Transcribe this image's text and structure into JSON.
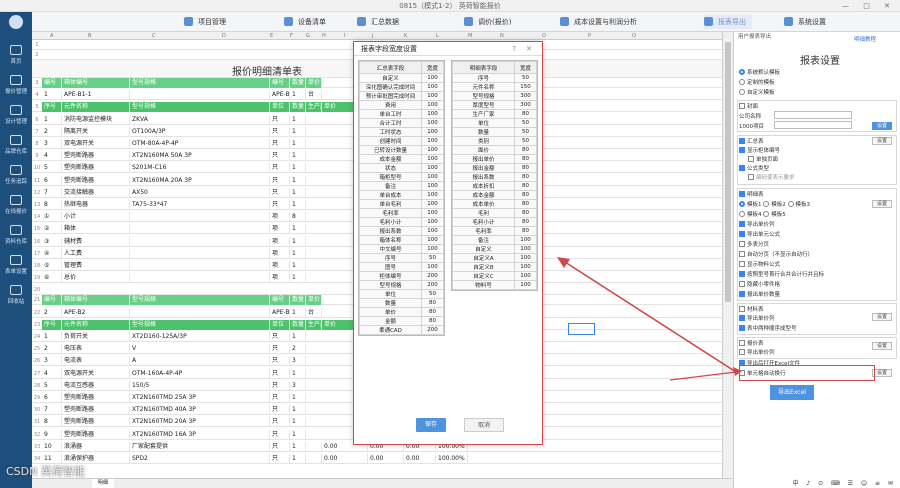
{
  "window": {
    "title": "0815（模式1-2） 英荷智能报价",
    "controls": "— □ ✕"
  },
  "toolbar": {
    "items": [
      "项目管理",
      "设备清单",
      "汇总数据",
      "调价(报价)",
      "成本设置与利润分析",
      "报表导出",
      "系统设置"
    ],
    "active_index": 5
  },
  "leftnav": [
    "首页",
    "报价管理",
    "设计管理",
    "品牌仓库",
    "任务追踪",
    "在线报价",
    "资料仓库",
    "表单设置",
    "回收站"
  ],
  "sheet": {
    "columns": [
      "A",
      "B",
      "C",
      "D",
      "E",
      "F",
      "G",
      "H",
      "I",
      "J",
      "K",
      "L",
      "M",
      "N",
      "O",
      "P",
      "Q"
    ],
    "title": "报价明细清单表",
    "rows": [
      {
        "n": "3",
        "type": "green2",
        "cells": [
          "编号",
          "箱体编号",
          "",
          "型号规格",
          "",
          "编号",
          "数量",
          "单价"
        ]
      },
      {
        "n": "4",
        "type": "plain",
        "cells": [
          "1",
          "APE-B1-1",
          "",
          "",
          "",
          "APE-B",
          "1",
          "台"
        ]
      },
      {
        "n": "5",
        "type": "green",
        "cells": [
          "序号",
          "元件名称",
          "",
          "型号规格",
          "",
          "单位",
          "数量",
          "生产厂商",
          "单价"
        ]
      },
      {
        "n": "6",
        "type": "plain",
        "cells": [
          "1",
          "消防电源监控模块",
          "",
          "ZKVA",
          "",
          "只",
          "1"
        ]
      },
      {
        "n": "7",
        "type": "plain",
        "cells": [
          "2",
          "隔离开关",
          "",
          "OT100A/3P",
          "",
          "只",
          "1"
        ]
      },
      {
        "n": "8",
        "type": "plain",
        "cells": [
          "3",
          "双电源开关",
          "",
          "OTM-80A-4P-4P",
          "",
          "只",
          "1"
        ]
      },
      {
        "n": "9",
        "type": "plain",
        "cells": [
          "4",
          "塑壳断路器",
          "",
          "XT2N160MA 50A 3P",
          "",
          "只",
          "1"
        ]
      },
      {
        "n": "10",
        "type": "plain",
        "cells": [
          "5",
          "塑壳断路器",
          "",
          "S201M-C16",
          "",
          "只",
          "1"
        ]
      },
      {
        "n": "11",
        "type": "plain",
        "cells": [
          "6",
          "塑壳断路器",
          "",
          "XT2N160MA 20A 3P",
          "",
          "只",
          "1"
        ]
      },
      {
        "n": "12",
        "type": "plain",
        "cells": [
          "7",
          "交流接触器",
          "",
          "AX50",
          "",
          "只",
          "1"
        ]
      },
      {
        "n": "13",
        "type": "plain",
        "cells": [
          "8",
          "热继电器",
          "",
          "TA75-33*47",
          "",
          "只",
          "1"
        ]
      },
      {
        "n": "14",
        "type": "plain",
        "cells": [
          "①",
          "小计",
          "",
          "",
          "",
          "项",
          "8"
        ]
      },
      {
        "n": "15",
        "type": "plain",
        "cells": [
          "②",
          "箱体",
          "",
          "",
          "",
          "项",
          "1"
        ]
      },
      {
        "n": "16",
        "type": "plain",
        "cells": [
          "③",
          "辅材费",
          "",
          "",
          "",
          "项",
          "1"
        ]
      },
      {
        "n": "17",
        "type": "plain",
        "cells": [
          "④",
          "人工费",
          "",
          "",
          "",
          "项",
          "1"
        ]
      },
      {
        "n": "18",
        "type": "plain",
        "cells": [
          "⑤",
          "管理费",
          "",
          "",
          "",
          "项",
          "1"
        ]
      },
      {
        "n": "19",
        "type": "plain",
        "cells": [
          "⑥",
          "总价",
          "",
          "",
          "",
          "项",
          "1"
        ]
      },
      {
        "n": "20",
        "type": "plain",
        "cells": []
      },
      {
        "n": "21",
        "type": "green2",
        "cells": [
          "编号",
          "箱体编号",
          "",
          "型号规格",
          "",
          "编号",
          "数量",
          "单价"
        ]
      },
      {
        "n": "22",
        "type": "plain",
        "cells": [
          "2",
          "APE-B2",
          "",
          "",
          "",
          "APE-B",
          "1",
          "台"
        ]
      },
      {
        "n": "23",
        "type": "green",
        "cells": [
          "序号",
          "元件名称",
          "",
          "型号规格",
          "",
          "单位",
          "数量",
          "生产厂商",
          "单价"
        ]
      },
      {
        "n": "24",
        "type": "plain",
        "cells": [
          "1",
          "负荷开关",
          "",
          "XT2D160-125A/3P",
          "",
          "只",
          "1"
        ]
      },
      {
        "n": "25",
        "type": "plain",
        "cells": [
          "2",
          "电压表",
          "",
          "V",
          "",
          "只",
          "2"
        ]
      },
      {
        "n": "26",
        "type": "plain",
        "cells": [
          "3",
          "电流表",
          "",
          "A",
          "",
          "只",
          "3"
        ]
      },
      {
        "n": "27",
        "type": "plain",
        "cells": [
          "4",
          "双电源开关",
          "",
          "OTM-160A-4P-4P",
          "",
          "只",
          "1"
        ]
      },
      {
        "n": "28",
        "type": "plain",
        "cells": [
          "5",
          "电流互感器",
          "",
          "150/5",
          "",
          "只",
          "3"
        ]
      },
      {
        "n": "29",
        "type": "plain",
        "cells": [
          "6",
          "塑壳断路器",
          "",
          "XT2N160TMD 25A 3P",
          "",
          "只",
          "1"
        ]
      },
      {
        "n": "30",
        "type": "plain",
        "cells": [
          "7",
          "塑壳断路器",
          "",
          "XT2N160TMD 40A 3P",
          "",
          "只",
          "1"
        ]
      },
      {
        "n": "31",
        "type": "plain",
        "cells": [
          "8",
          "塑壳断路器",
          "",
          "XT2N160TMD 20A 3P",
          "",
          "只",
          "1"
        ]
      },
      {
        "n": "32",
        "type": "plain",
        "cells": [
          "9",
          "塑壳断路器",
          "",
          "XT2N160TMD 16A 3P",
          "",
          "只",
          "1"
        ]
      },
      {
        "n": "33",
        "type": "plain",
        "cells": [
          "10",
          "浪涌器",
          "",
          "厂家配套提供",
          "",
          "只",
          "1",
          "",
          "0.00",
          "0.00",
          "0.00",
          "100.00%"
        ]
      },
      {
        "n": "34",
        "type": "plain",
        "cells": [
          "11",
          "浪涌保护器",
          "",
          "SPD2",
          "",
          "只",
          "1",
          "",
          "0.00",
          "0.00",
          "0.00",
          "100.00%"
        ]
      }
    ]
  },
  "dialog": {
    "title": "报表字段宽度设置",
    "controls": "? ✕",
    "left_header": [
      "汇总表字段",
      "宽度"
    ],
    "left_rows": [
      [
        "自定义",
        "100"
      ],
      [
        "深化图确认完成时间",
        "100"
      ],
      [
        "预计审批图完成时间",
        "100"
      ],
      [
        "费用",
        "100"
      ],
      [
        "单台工时",
        "100"
      ],
      [
        "合计工时",
        "100"
      ],
      [
        "工时状态",
        "100"
      ],
      [
        "创建时间",
        "100"
      ],
      [
        "已转设计数量",
        "100"
      ],
      [
        "成本金额",
        "100"
      ],
      [
        "状态",
        "100"
      ],
      [
        "箱柜型号",
        "100"
      ],
      [
        "备注",
        "100"
      ],
      [
        "单台成本",
        "100"
      ],
      [
        "单台毛利",
        "100"
      ],
      [
        "毛利率",
        "100"
      ],
      [
        "毛利小计",
        "100"
      ],
      [
        "报出系数",
        "100"
      ],
      [
        "箱体名称",
        "100"
      ],
      [
        "中文编号",
        "100"
      ],
      [
        "序号",
        "50"
      ],
      [
        "图号",
        "100"
      ],
      [
        "柜体编号",
        "200"
      ],
      [
        "型号规格",
        "200"
      ],
      [
        "单位",
        "50"
      ],
      [
        "数量",
        "80"
      ],
      [
        "单价",
        "80"
      ],
      [
        "金额",
        "80"
      ],
      [
        "柔通CAD",
        "200"
      ]
    ],
    "right_header": [
      "明细表字段",
      "宽度"
    ],
    "right_rows": [
      [
        "序号",
        "50"
      ],
      [
        "元件名称",
        "150"
      ],
      [
        "型号规格",
        "300"
      ],
      [
        "厚度型号",
        "300"
      ],
      [
        "生产厂家",
        "80"
      ],
      [
        "单位",
        "50"
      ],
      [
        "数量",
        "50"
      ],
      [
        "类别",
        "50"
      ],
      [
        "面价",
        "80"
      ],
      [
        "报出单价",
        "80"
      ],
      [
        "报出金额",
        "80"
      ],
      [
        "报出系数",
        "80"
      ],
      [
        "成本折扣",
        "80"
      ],
      [
        "成本金额",
        "80"
      ],
      [
        "成本单价",
        "80"
      ],
      [
        "毛利",
        "80"
      ],
      [
        "毛利小计",
        "80"
      ],
      [
        "毛利率",
        "80"
      ],
      [
        "备注",
        "100"
      ],
      [
        "自定义",
        "100"
      ],
      [
        "自定义A",
        "100"
      ],
      [
        "自定义B",
        "100"
      ],
      [
        "自定义C",
        "100"
      ],
      [
        "物料号",
        "100"
      ]
    ],
    "save": "保存",
    "cancel": "取消"
  },
  "panel": {
    "header": "用户报表导出",
    "help": "明细教程",
    "title": "报表设置",
    "template_modes": [
      "系统默认模板",
      "定制的模板",
      "自定义模板"
    ],
    "cover_label": "封面",
    "cover_company": "公司名称",
    "cover_field": "1000项目",
    "cover_btn": "设置",
    "summary_label": "汇总表",
    "summary_btn": "设置",
    "summary_opts": [
      "显示柜体编号",
      "单独页面",
      "公式类型",
      "编码使表示要求"
    ],
    "detail_label": "明细表",
    "detail_btn": "设置",
    "detail_models": [
      "模板1",
      "模板2",
      "模板3",
      "模板4",
      "模板5"
    ],
    "detail_opts": [
      "导出单价列",
      "导出单元公式",
      "多表分页",
      "自动分页（不显示自动行）",
      "显示物料公式",
      "按照型号首行合并合计行并且标",
      "隐藏小零件格",
      "报出单价数量"
    ],
    "material_label": "材料表",
    "material_opts": [
      "导出单价列",
      "表中两种顺序成型号"
    ],
    "material_btn": "设置",
    "price_label": "报价表",
    "price_opts": [
      "导出单价列"
    ],
    "price_btn": "设置",
    "export_open": "导出后打开Excel文件",
    "autowrap": "单元格自动换行",
    "autowrap_btn": "设置",
    "export_btn": "导出Excel"
  },
  "bottom": {
    "tab": "明细"
  },
  "watermark": "CSDN 英荷智能",
  "tray": "中 ♪ ⊙ ⌨ ☰ ☺ ≡ ✉"
}
